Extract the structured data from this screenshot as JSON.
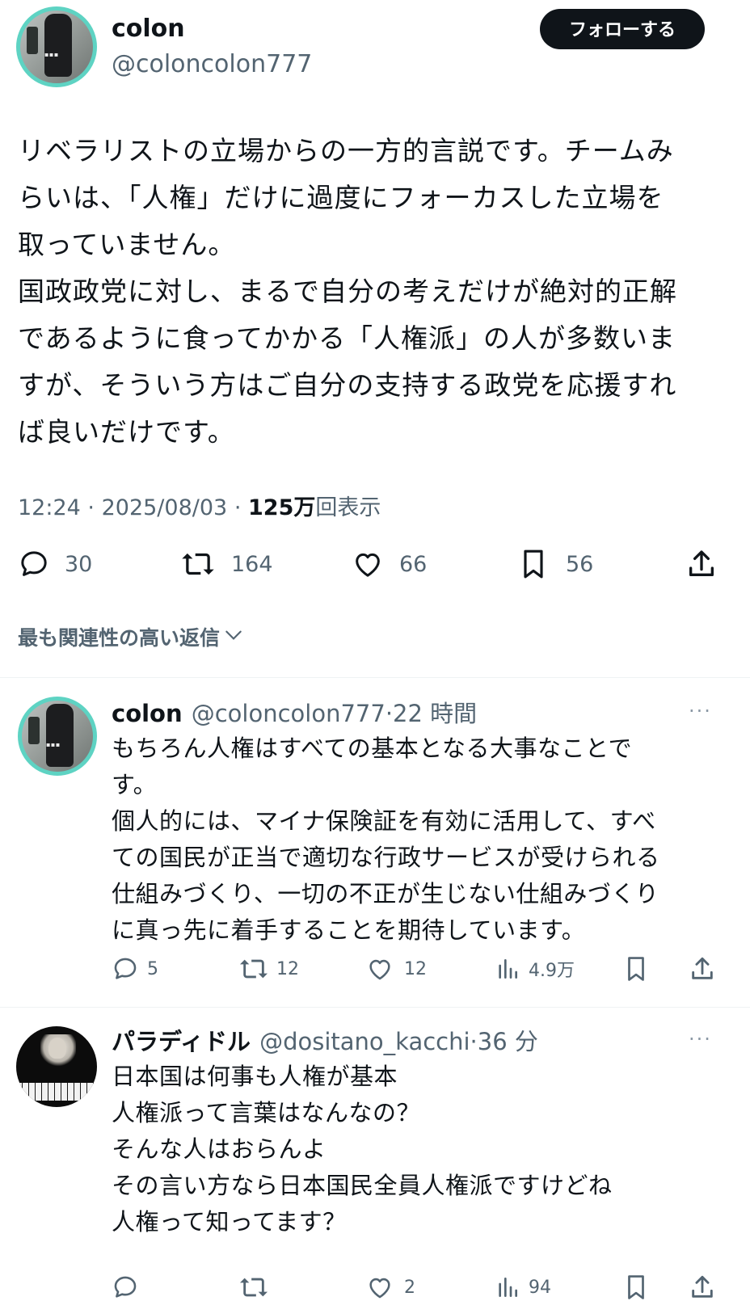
{
  "main_post": {
    "author_name": "colon",
    "author_handle": "@coloncolon777",
    "follow_label": "フォローする",
    "text_lines": [
      "リベラリストの立場からの一方的言説です。チームみ",
      "らいは、「人権」だけに過度にフォーカスした立場を",
      "取っていません。",
      "国政政党に対し、まるで自分の考えだけが絶対的正解",
      "であるように食ってかかる「人権派」の人が多数いま",
      "すが、そういう方はご自分の支持する政党を応援すれ",
      "ば良いだけです。"
    ],
    "time": "12:24",
    "separator": "·",
    "date": "2025/08/03",
    "views_count": "125万",
    "views_label": "回表示",
    "replies": "30",
    "reposts": "164",
    "likes": "66",
    "bookmarks": "56"
  },
  "sort_label": "最も関連性の高い返信",
  "replies": [
    {
      "author_name": "colon",
      "author_handle": "@coloncolon777",
      "time_ago": "·22 時間",
      "more": "···",
      "text_lines": [
        "もちろん人権はすべての基本となる大事なことで",
        "す。",
        "個人的には、マイナ保険証を有効に活用して、すべ",
        "ての国民が正当で適切な行政サービスが受けられる",
        "仕組みづくり、一切の不正が生じない仕組みづくり",
        "に真っ先に着手することを期待しています。"
      ],
      "replies": "5",
      "reposts": "12",
      "likes": "12",
      "views": "4.9万"
    },
    {
      "author_name": "パラディドル",
      "author_handle": "@dositano_kacchi",
      "time_ago": "·36 分",
      "more": "···",
      "text_lines": [
        "日本国は何事も人権が基本",
        "人権派って言葉はなんなの？",
        "そんな人はおらんよ",
        "その言い方なら日本国民全員人権派ですけどね",
        "人権って知ってます？"
      ],
      "replies": "",
      "reposts": "",
      "likes": "2",
      "views": "94"
    }
  ],
  "colors": {
    "text": "#0f1419",
    "secondary": "#536471",
    "avatar_ring": "#5ed3c3",
    "divider": "#eff3f4"
  },
  "icons": [
    "reply-icon",
    "repost-icon",
    "like-icon",
    "bookmark-icon",
    "share-icon",
    "views-icon",
    "chevron-down-icon",
    "more-icon"
  ]
}
